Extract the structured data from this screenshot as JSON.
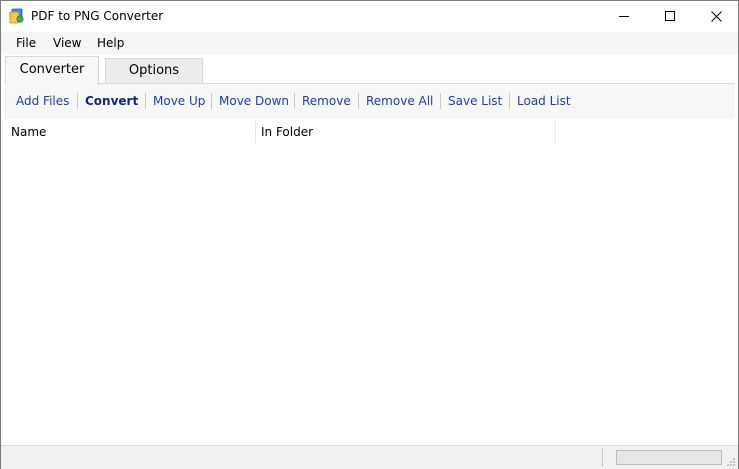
{
  "window": {
    "title": "PDF to PNG Converter"
  },
  "menu": {
    "items": [
      "File",
      "View",
      "Help"
    ]
  },
  "tabs": {
    "items": [
      {
        "label": "Converter",
        "active": true
      },
      {
        "label": "Options",
        "active": false
      }
    ]
  },
  "toolbar": {
    "buttons": [
      {
        "label": "Add Files"
      },
      {
        "label": "Convert"
      },
      {
        "label": "Move Up"
      },
      {
        "label": "Move Down"
      },
      {
        "label": "Remove"
      },
      {
        "label": "Remove All"
      },
      {
        "label": "Save List"
      },
      {
        "label": "Load List"
      }
    ]
  },
  "list": {
    "columns": [
      "Name",
      "In Folder"
    ],
    "rows": []
  },
  "status": {
    "progress_fraction": 0
  },
  "colors": {
    "link": "#1f3dad",
    "toolbar_bg": "#f7f7f7"
  },
  "icons": {
    "app": "pdf-png-app-icon",
    "minimize": "minimize-icon",
    "maximize": "maximize-icon",
    "close": "close-icon"
  }
}
